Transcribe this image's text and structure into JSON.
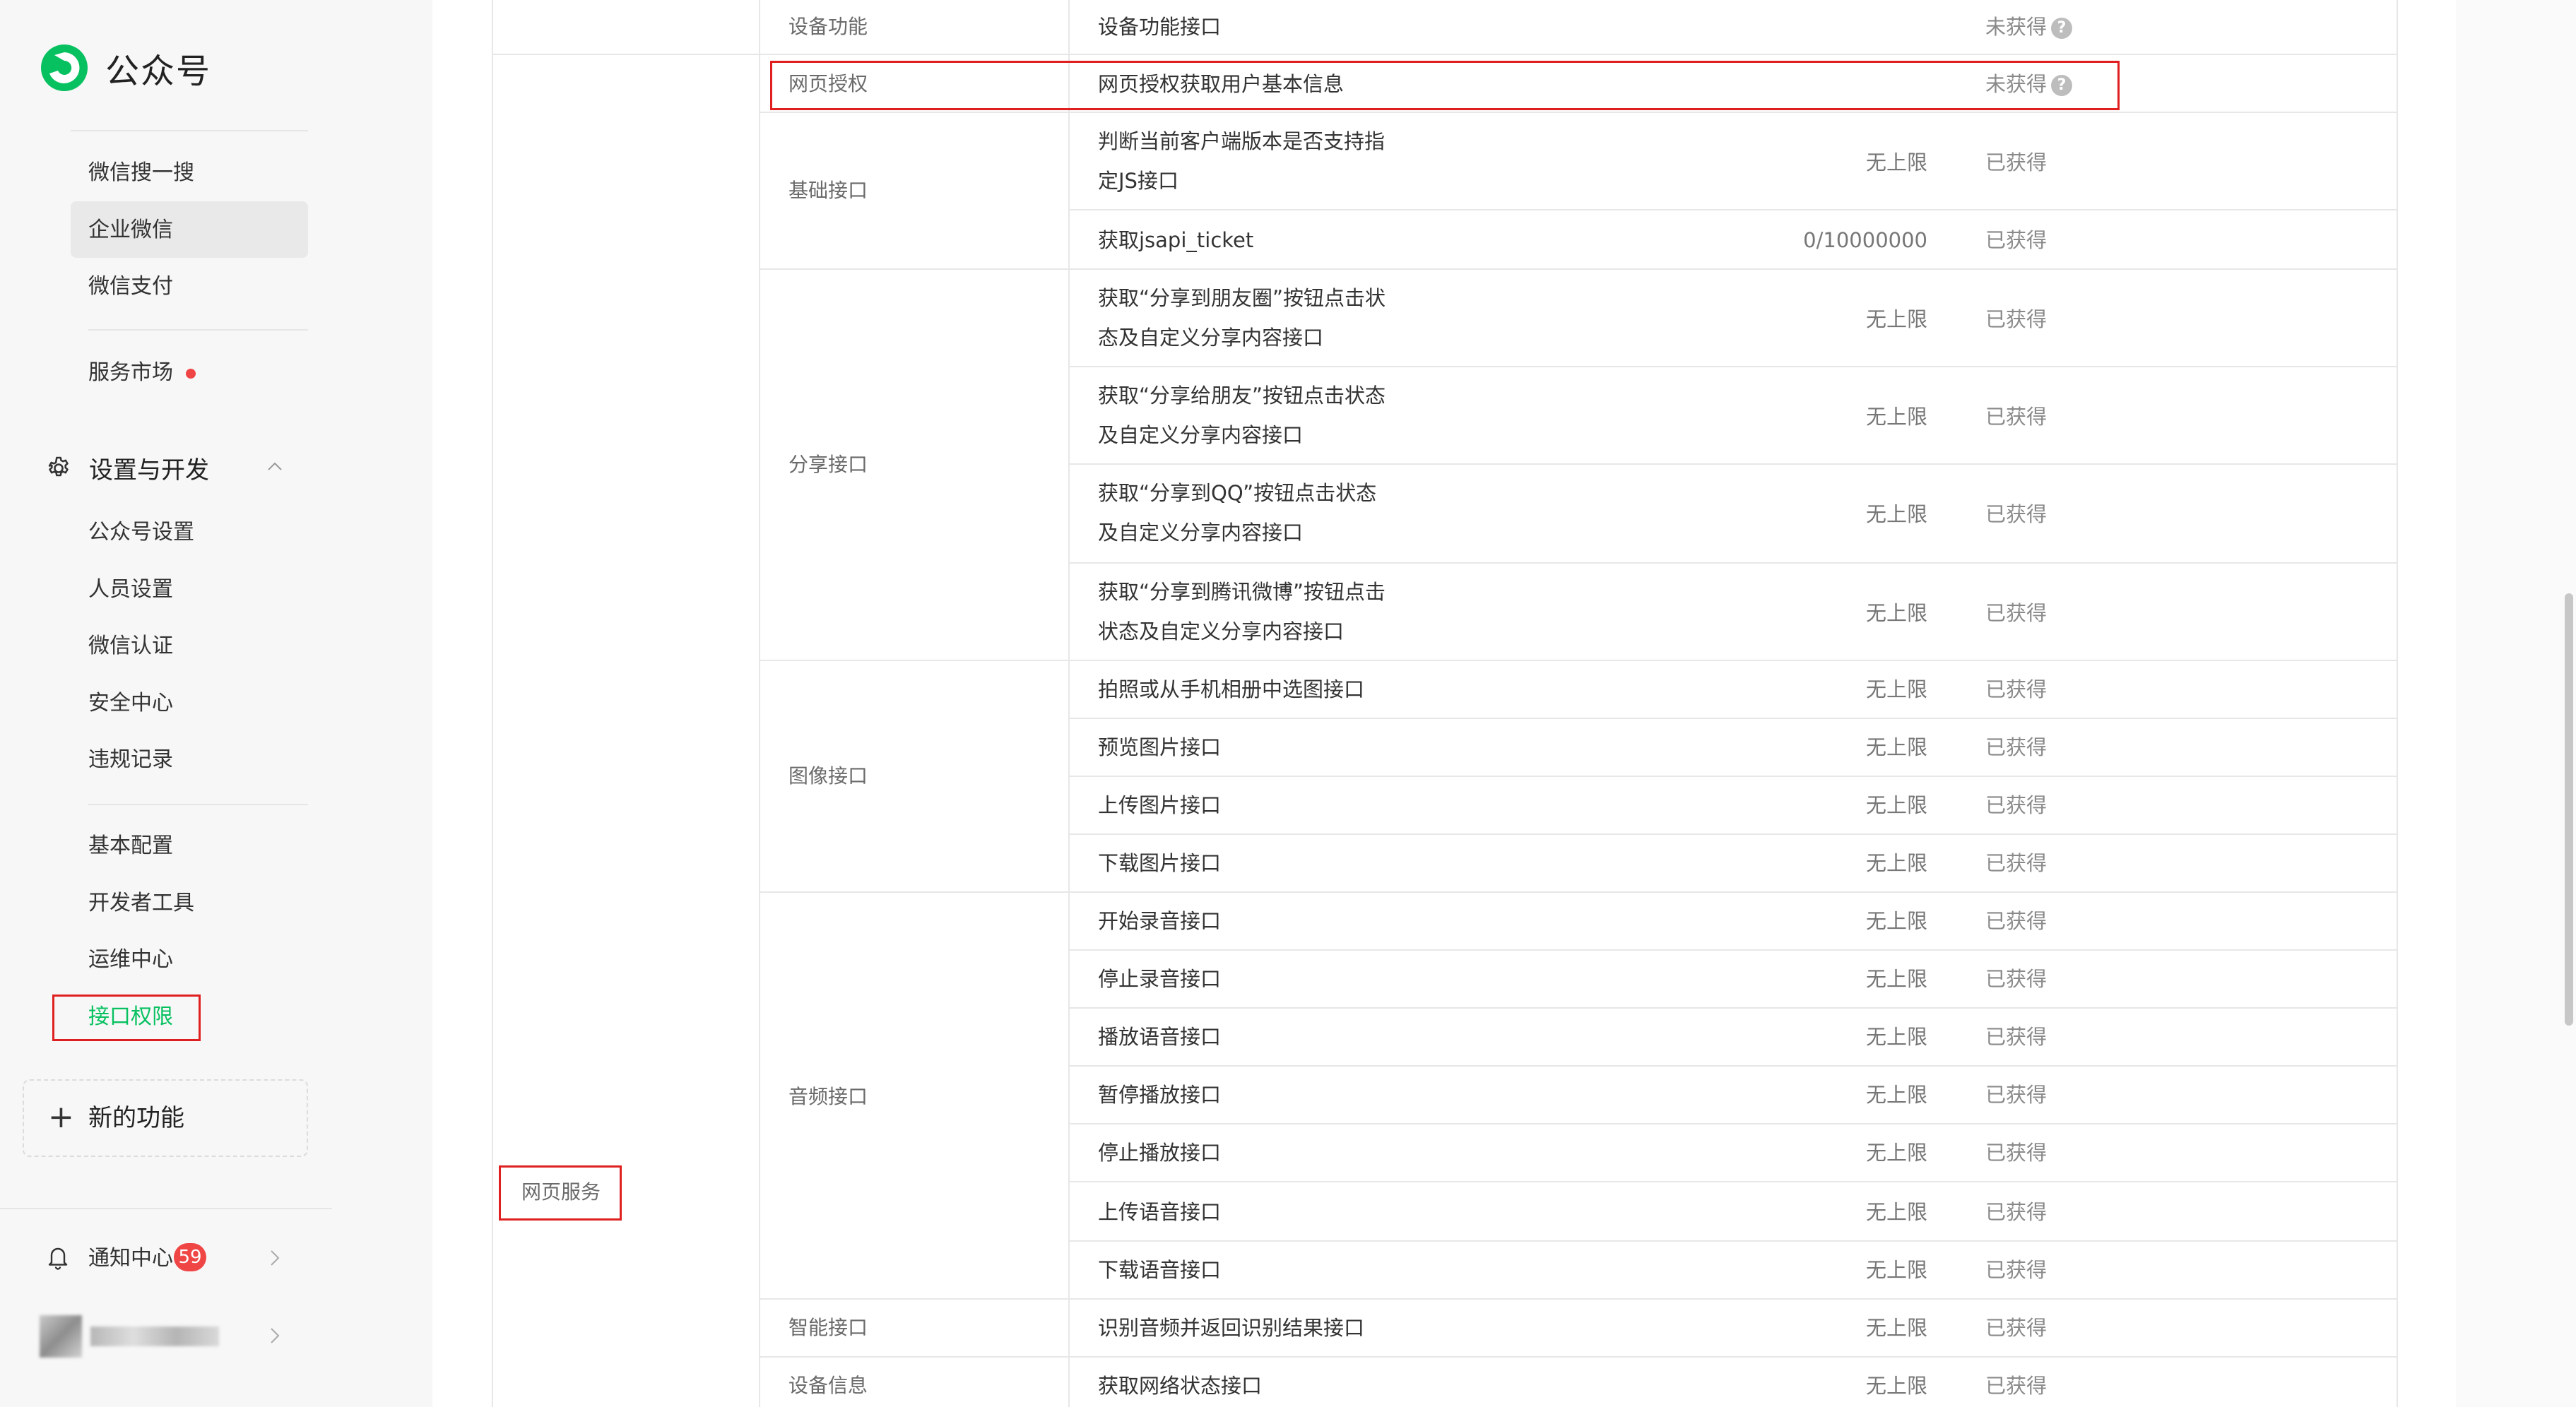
{
  "brand": {
    "name": "公众号",
    "accent": "#07c160"
  },
  "sidebar": {
    "items_top": [
      {
        "label": "微信搜一搜"
      },
      {
        "label": "企业微信"
      },
      {
        "label": "微信支付"
      },
      {
        "label": "服务市场"
      }
    ],
    "section": {
      "label": "设置与开发",
      "icon": "gear-icon",
      "expanded": true
    },
    "items_settings": [
      {
        "label": "公众号设置"
      },
      {
        "label": "人员设置"
      },
      {
        "label": "微信认证"
      },
      {
        "label": "安全中心"
      },
      {
        "label": "违规记录"
      }
    ],
    "items_dev": [
      {
        "label": "基本配置"
      },
      {
        "label": "开发者工具"
      },
      {
        "label": "运维中心"
      },
      {
        "label": "接口权限"
      }
    ],
    "new_feature": "新的功能",
    "notice": {
      "label": "通知中心",
      "count": "59"
    }
  },
  "table": {
    "service_label": "网页服务",
    "rows": [
      {
        "category": "设备功能",
        "api": "设备功能接口",
        "limit": "",
        "status": "未获得",
        "help": true
      },
      {
        "category": "网页授权",
        "api": "网页授权获取用户基本信息",
        "limit": "",
        "status": "未获得",
        "help": true
      },
      {
        "category": "基础接口",
        "api": "判断当前客户端版本是否支持指定JS接口",
        "limit": "无上限",
        "status": "已获得"
      },
      {
        "category": "",
        "api": "获取jsapi_ticket",
        "limit": "0/10000000",
        "status": "已获得"
      },
      {
        "category": "分享接口",
        "api": "获取“分享到朋友圈”按钮点击状态及自定义分享内容接口",
        "limit": "无上限",
        "status": "已获得"
      },
      {
        "category": "",
        "api": "获取“分享给朋友”按钮点击状态及自定义分享内容接口",
        "limit": "无上限",
        "status": "已获得"
      },
      {
        "category": "",
        "api": "获取“分享到QQ”按钮点击状态及自定义分享内容接口",
        "limit": "无上限",
        "status": "已获得"
      },
      {
        "category": "",
        "api": "获取“分享到腾讯微博”按钮点击状态及自定义分享内容接口",
        "limit": "无上限",
        "status": "已获得"
      },
      {
        "category": "图像接口",
        "api": "拍照或从手机相册中选图接口",
        "limit": "无上限",
        "status": "已获得"
      },
      {
        "category": "",
        "api": "预览图片接口",
        "limit": "无上限",
        "status": "已获得"
      },
      {
        "category": "",
        "api": "上传图片接口",
        "limit": "无上限",
        "status": "已获得"
      },
      {
        "category": "",
        "api": "下载图片接口",
        "limit": "无上限",
        "status": "已获得"
      },
      {
        "category": "音频接口",
        "api": "开始录音接口",
        "limit": "无上限",
        "status": "已获得"
      },
      {
        "category": "",
        "api": "停止录音接口",
        "limit": "无上限",
        "status": "已获得"
      },
      {
        "category": "",
        "api": "播放语音接口",
        "limit": "无上限",
        "status": "已获得"
      },
      {
        "category": "",
        "api": "暂停播放接口",
        "limit": "无上限",
        "status": "已获得"
      },
      {
        "category": "",
        "api": "停止播放接口",
        "limit": "无上限",
        "status": "已获得"
      },
      {
        "category": "",
        "api": "上传语音接口",
        "limit": "无上限",
        "status": "已获得"
      },
      {
        "category": "",
        "api": "下载语音接口",
        "limit": "无上限",
        "status": "已获得"
      },
      {
        "category": "智能接口",
        "api": "识别音频并返回识别结果接口",
        "limit": "无上限",
        "status": "已获得"
      },
      {
        "category": "设备信息",
        "api": "获取网络状态接口",
        "limit": "无上限",
        "status": "已获得"
      }
    ]
  }
}
